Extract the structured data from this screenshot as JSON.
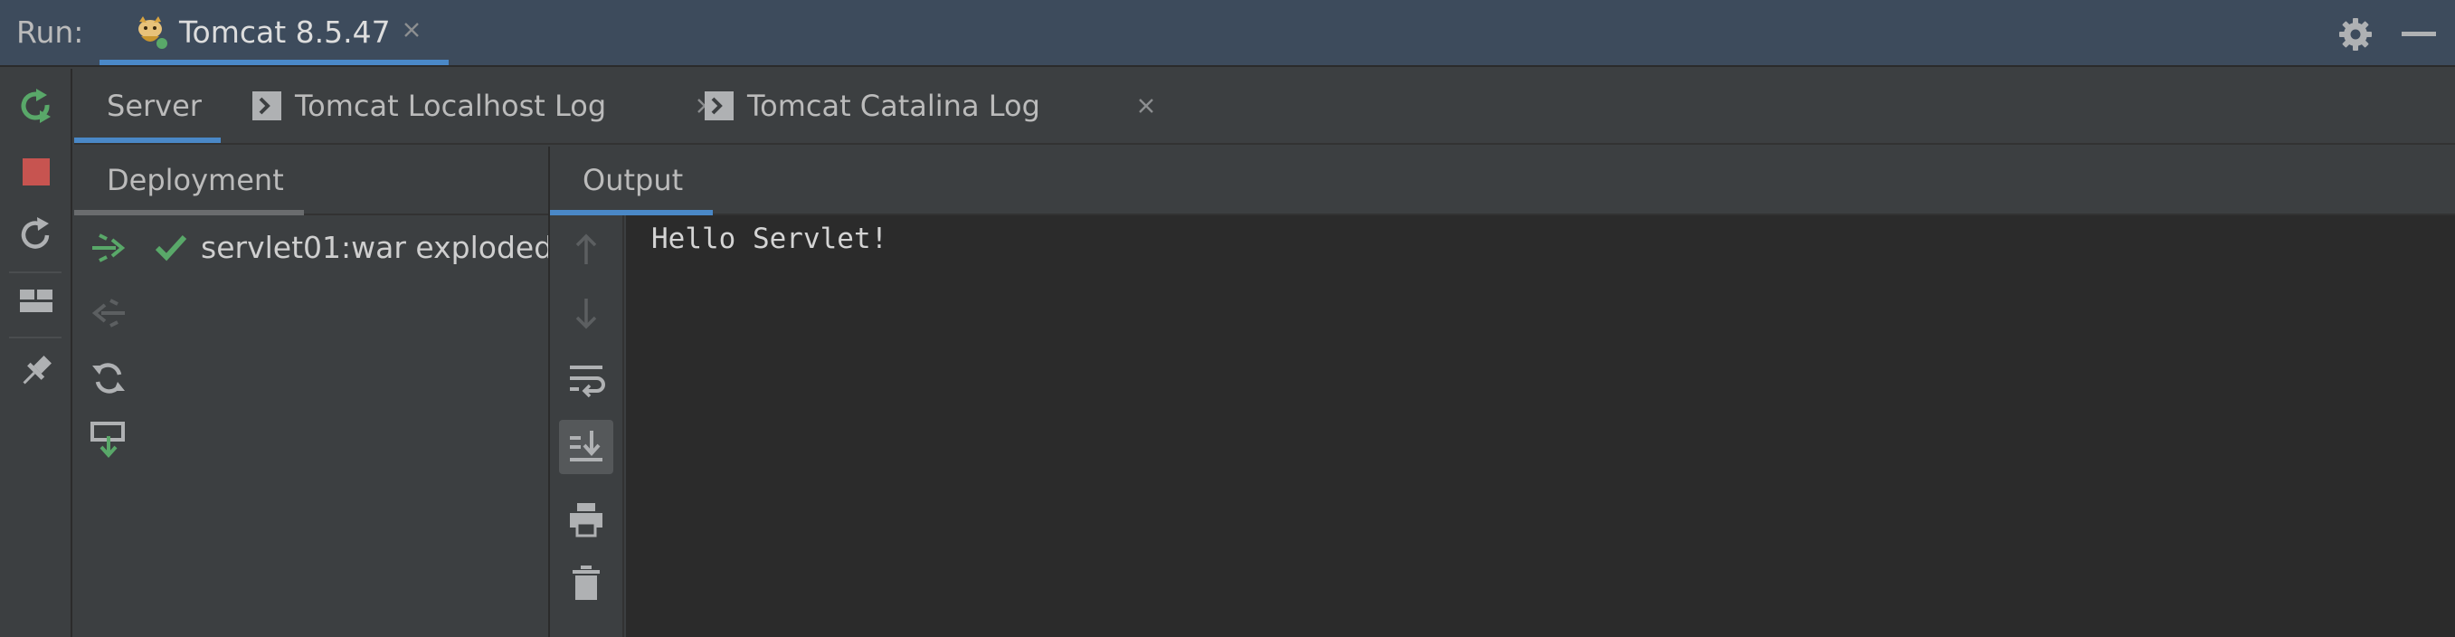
{
  "run_bar": {
    "label": "Run:",
    "active_tab": {
      "label": "Tomcat 8.5.47",
      "icon": "tomcat-icon"
    },
    "actions": [
      {
        "icon": "gear-icon"
      },
      {
        "icon": "minimize-icon"
      }
    ]
  },
  "left_toolbar": {
    "buttons": [
      {
        "icon": "rerun-icon"
      },
      {
        "icon": "stop-icon",
        "color": "#c75450"
      },
      {
        "icon": "restart-icon"
      },
      {
        "icon": "layout-icon"
      },
      {
        "icon": "pin-icon"
      }
    ]
  },
  "server_tabs": [
    {
      "label": "Server",
      "active": true
    },
    {
      "label": "Tomcat Localhost Log",
      "closable": true,
      "icon": "console-log-icon"
    },
    {
      "label": "Tomcat Catalina Log",
      "closable": true,
      "icon": "console-log-icon"
    }
  ],
  "deployment": {
    "title": "Deployment",
    "items": [
      {
        "label": "servlet01:war exploded",
        "status": "deployed",
        "status_icon": "check-icon"
      }
    ],
    "actions": [
      {
        "icon": "deploy-icon"
      },
      {
        "icon": "undeploy-icon",
        "disabled": true
      },
      {
        "icon": "refresh-icon"
      },
      {
        "icon": "deploy-all-icon"
      }
    ]
  },
  "output": {
    "title": "Output",
    "toolbar": [
      {
        "icon": "arrow-up-icon",
        "disabled": true
      },
      {
        "icon": "arrow-down-icon",
        "disabled": true
      },
      {
        "icon": "soft-wrap-icon"
      },
      {
        "icon": "scroll-to-end-icon",
        "active": true
      },
      {
        "icon": "print-icon"
      },
      {
        "icon": "trash-icon"
      }
    ],
    "console_text": "Hello Servlet!"
  },
  "colors": {
    "accent": "#4a88c7",
    "run_green": "#59a869",
    "stop_red": "#c75450",
    "panel_bg": "#3c3f41",
    "console_bg": "#2b2b2b"
  }
}
